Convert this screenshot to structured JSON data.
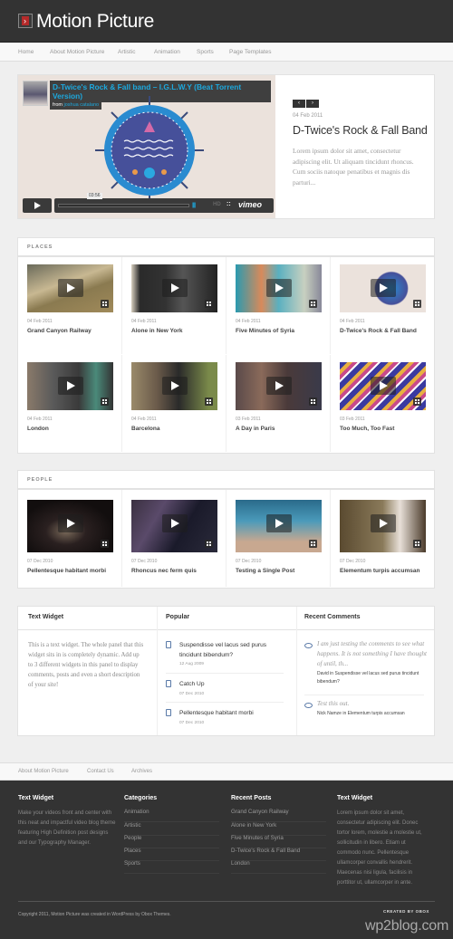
{
  "site": {
    "title": "Motion Picture",
    "logo_glyph": "›"
  },
  "nav": {
    "items": [
      "Home",
      "About Motion Picture",
      "Artistic",
      "Animation",
      "Sports",
      "Page Templates"
    ]
  },
  "featured": {
    "video_title": "D-Twice's Rock & Fall band – I.G.L.W.Y (Beat Torrent Version)",
    "from_label": "from",
    "author": "joshua catalano",
    "duration": "03:56",
    "hd_label": "HD",
    "provider": "vimeo",
    "prev_label": "‹",
    "next_label": "›",
    "date": "04 Feb 2011",
    "title": "D-Twice's Rock & Fall Band",
    "excerpt": "Lorem ipsum dolor sit amet, consectetur adipiscing elit. Ut aliquam tincidunt rhoncus. Cum sociis natoque penatibus et magnis dis parturi..."
  },
  "places": {
    "label": "PLACES",
    "items": [
      {
        "date": "04 Feb 2011",
        "title": "Grand Canyon Railway"
      },
      {
        "date": "04 Feb 2011",
        "title": "Alone in New York"
      },
      {
        "date": "04 Feb 2011",
        "title": "Five Minutes of Syria"
      },
      {
        "date": "04 Feb 2011",
        "title": "D-Twice's Rock & Fall Band"
      },
      {
        "date": "04 Feb 2011",
        "title": "London"
      },
      {
        "date": "04 Feb 2011",
        "title": "Barcelona"
      },
      {
        "date": "03 Feb 2011",
        "title": "A Day in Paris"
      },
      {
        "date": "03 Feb 2011",
        "title": "Too Much, Too Fast"
      }
    ]
  },
  "people": {
    "label": "PEOPLE",
    "items": [
      {
        "date": "07 Dec 2010",
        "title": "Pellentesque habitant morbi"
      },
      {
        "date": "07 Dec 2010",
        "title": "Rhoncus nec ferm quis"
      },
      {
        "date": "07 Dec 2010",
        "title": "Testing a Single Post"
      },
      {
        "date": "07 Dec 2010",
        "title": "Elementum turpis accumsan"
      }
    ]
  },
  "widgets": {
    "text": {
      "title": "Text Widget",
      "body": "This is a text widget. The whole panel that this widget sits in is completely dynamic. Add up to 3 different widgets in this panel to display comments, posts and even a short description of your site!"
    },
    "popular": {
      "title": "Popular",
      "items": [
        {
          "title": "Suspendisse vel lacus sed purus tincidunt bibendum?",
          "date": "12 Aug 2009"
        },
        {
          "title": "Catch Up",
          "date": "07 Dec 2010"
        },
        {
          "title": "Pellentesque habitant morbi",
          "date": "07 Dec 2010"
        }
      ]
    },
    "comments": {
      "title": "Recent Comments",
      "items": [
        {
          "text": "I am just testing the comments to see what happens. It is not something I have thought of until, th...",
          "meta": "David in Suspendisse vel lacus sed purus tincidunt bibendum?"
        },
        {
          "text": "Test this out.",
          "meta": "Nick Namze in Elementum turpis accumsan"
        }
      ]
    }
  },
  "subnav": {
    "items": [
      "About Motion Picture",
      "Contact Us",
      "Archives"
    ]
  },
  "footer": {
    "text_widget": {
      "title": "Text Widget",
      "body": "Make your videos front and center with this neat and impactful video blog theme featuring High Definition post designs and our Typography Manager."
    },
    "categories": {
      "title": "Categories",
      "items": [
        "Animation",
        "Artistic",
        "People",
        "Places",
        "Sports"
      ]
    },
    "recent_posts": {
      "title": "Recent Posts",
      "items": [
        "Grand Canyon Railway",
        "Alone in New York",
        "Five Minutes of Syria",
        "D-Twice's Rock & Fall Band",
        "London"
      ]
    },
    "text_widget_2": {
      "title": "Text Widget",
      "body": "Lorem ipsum dolor sit amet, consectetur adipiscing elit. Donec tortor lorem, molestie a molestie ut, sollicitudin in libero. Etiam ut commodo nunc. Pellentesque ullamcorper convallis hendrerit. Maecenas nisi ligula, facilisis in porttitor ut, ullamcorper in ante."
    },
    "copyright": "Copyright 2011, Motion Picture was created in WordPress by Obox Themes.",
    "credit": "CREATED BY OBOX"
  },
  "watermark": "wp2blog.com"
}
